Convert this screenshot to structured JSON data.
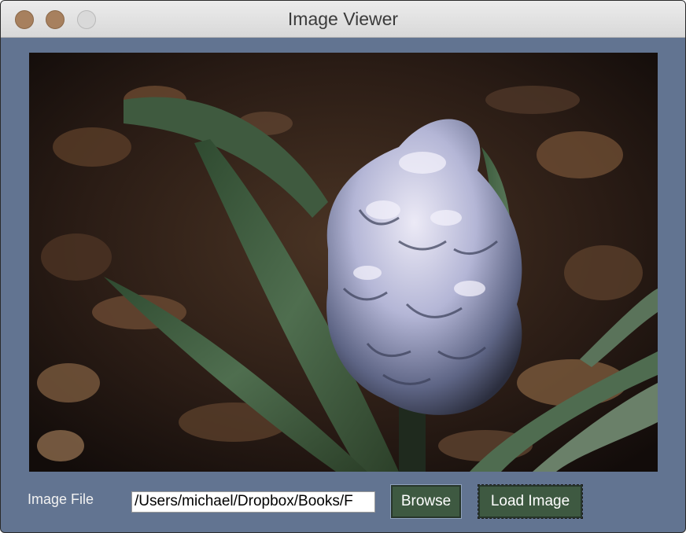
{
  "window": {
    "title": "Image Viewer"
  },
  "viewer": {
    "image_description_icon": "hyacinth-photo"
  },
  "form": {
    "label": "Image File",
    "path_value": "/Users/michael/Dropbox/Books/F",
    "browse_label": "Browse",
    "load_label": "Load Image"
  },
  "colors": {
    "window_bg": "#627491",
    "button_bg": "#3e5941",
    "titlebar_bg": "#e3e3e3"
  }
}
